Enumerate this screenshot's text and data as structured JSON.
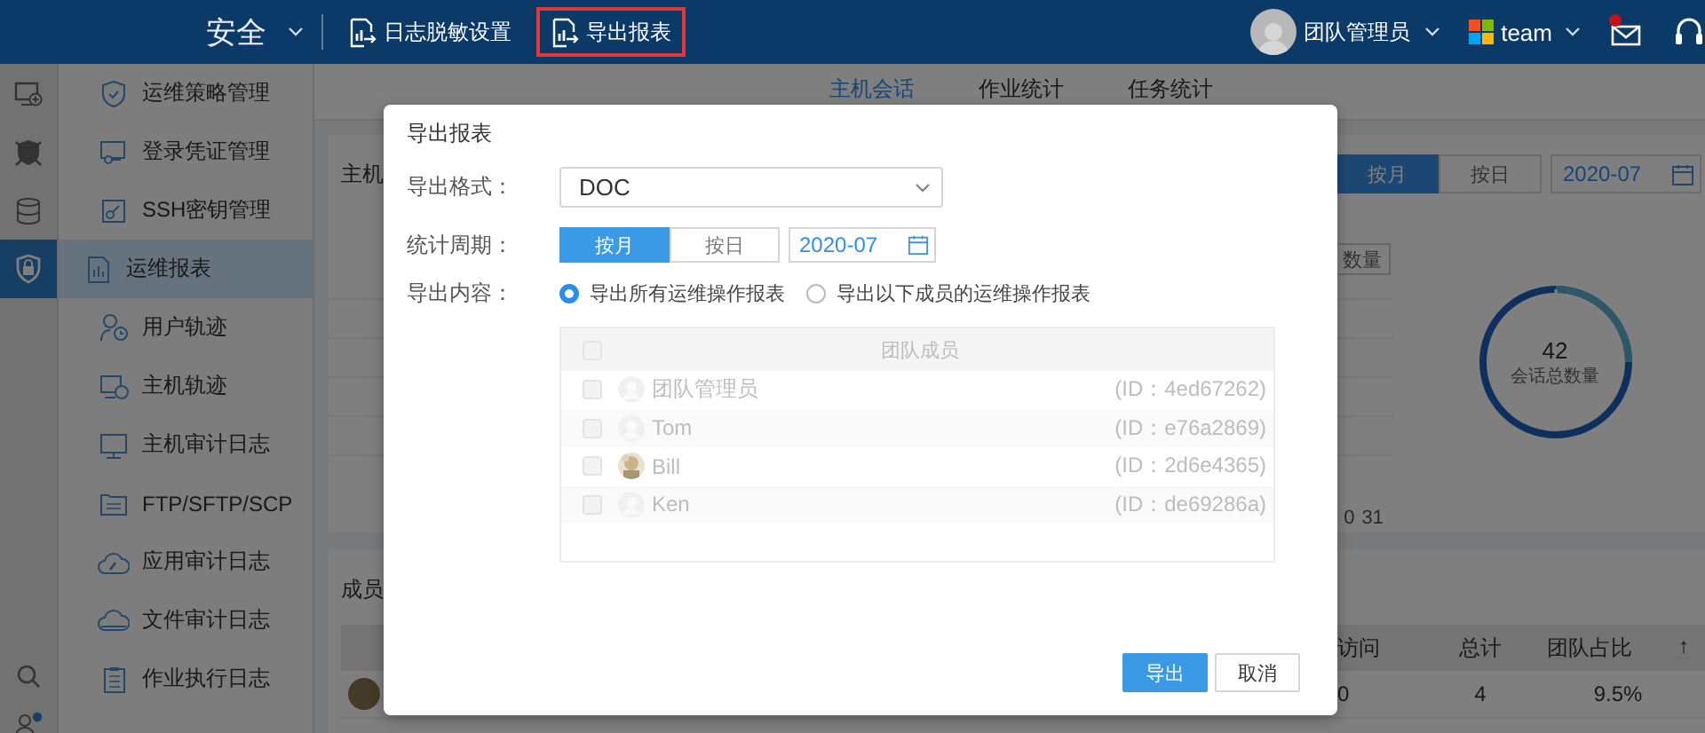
{
  "header": {
    "brand": "安全",
    "nav": [
      {
        "label": "日志脱敏设置",
        "highlighted": false
      },
      {
        "label": "导出报表",
        "highlighted": true
      }
    ],
    "user": {
      "name": "团队管理员"
    },
    "team": {
      "name": "team"
    },
    "mail": {
      "unread": true
    }
  },
  "rail": [
    {
      "selected": false
    },
    {
      "selected": false
    },
    {
      "selected": false
    },
    {
      "selected": true
    }
  ],
  "sidebar": {
    "items": [
      {
        "label": "运维策略管理",
        "selected": false
      },
      {
        "label": "登录凭证管理",
        "selected": false
      },
      {
        "label": "SSH密钥管理",
        "selected": false
      },
      {
        "label": "运维报表",
        "selected": true,
        "children": [
          {
            "label": "用户轨迹",
            "selected": false
          },
          {
            "label": "主机轨迹",
            "selected": false
          },
          {
            "label": "主机审计日志",
            "selected": false
          },
          {
            "label": "FTP/SFTP/SCP",
            "selected": false
          },
          {
            "label": "应用审计日志",
            "selected": false
          },
          {
            "label": "文件审计日志",
            "selected": false
          },
          {
            "label": "作业执行日志",
            "selected": false
          }
        ]
      }
    ]
  },
  "report": {
    "tabs": [
      {
        "label": "主机会话",
        "selected": true
      },
      {
        "label": "作业统计",
        "selected": false
      },
      {
        "label": "任务统计",
        "selected": false
      }
    ],
    "card_title": "主机",
    "period": [
      {
        "label": "按月",
        "selected": true
      },
      {
        "label": "按日",
        "selected": false
      }
    ],
    "date": "2020-07",
    "metric_button": "数量",
    "x_axis_labels": [
      "0",
      "31"
    ],
    "donut": {
      "value": "42",
      "label": "会话总数量"
    },
    "members_title": "成员",
    "table": {
      "columns": [
        {
          "label": "访问"
        },
        {
          "label": "总计"
        },
        {
          "label": "团队占比",
          "sort_mark": "↑"
        }
      ],
      "rows": [
        {
          "cells": [
            "0",
            "4",
            "9.5%"
          ]
        }
      ]
    }
  },
  "dialog": {
    "title": "导出报表",
    "format": {
      "label": "导出格式：",
      "value": "DOC"
    },
    "period": {
      "label": "统计周期：",
      "options": [
        {
          "label": "按月",
          "selected": true
        },
        {
          "label": "按日",
          "selected": false
        }
      ],
      "date": "2020-07"
    },
    "content": {
      "label": "导出内容：",
      "options": [
        {
          "label": "导出所有运维操作报表",
          "selected": true
        },
        {
          "label": "导出以下成员的运维操作报表",
          "selected": false
        }
      ]
    },
    "members": {
      "disabled": true,
      "header": "团队成员",
      "header_checked": false,
      "rows": [
        {
          "name": "团队管理员",
          "id": "(ID：4ed67262)",
          "checked": false,
          "kind": "default"
        },
        {
          "name": "Tom",
          "id": "(ID：e76a2869)",
          "checked": false,
          "kind": "default"
        },
        {
          "name": "Bill",
          "id": "(ID：2d6e4365)",
          "checked": false
        },
        {
          "name": "Ken",
          "id": "(ID：de69286a)",
          "checked": false,
          "kind": "default"
        }
      ]
    },
    "buttons": [
      {
        "label": "导出",
        "kind": "primary"
      },
      {
        "label": "取消",
        "kind": "default"
      }
    ]
  }
}
